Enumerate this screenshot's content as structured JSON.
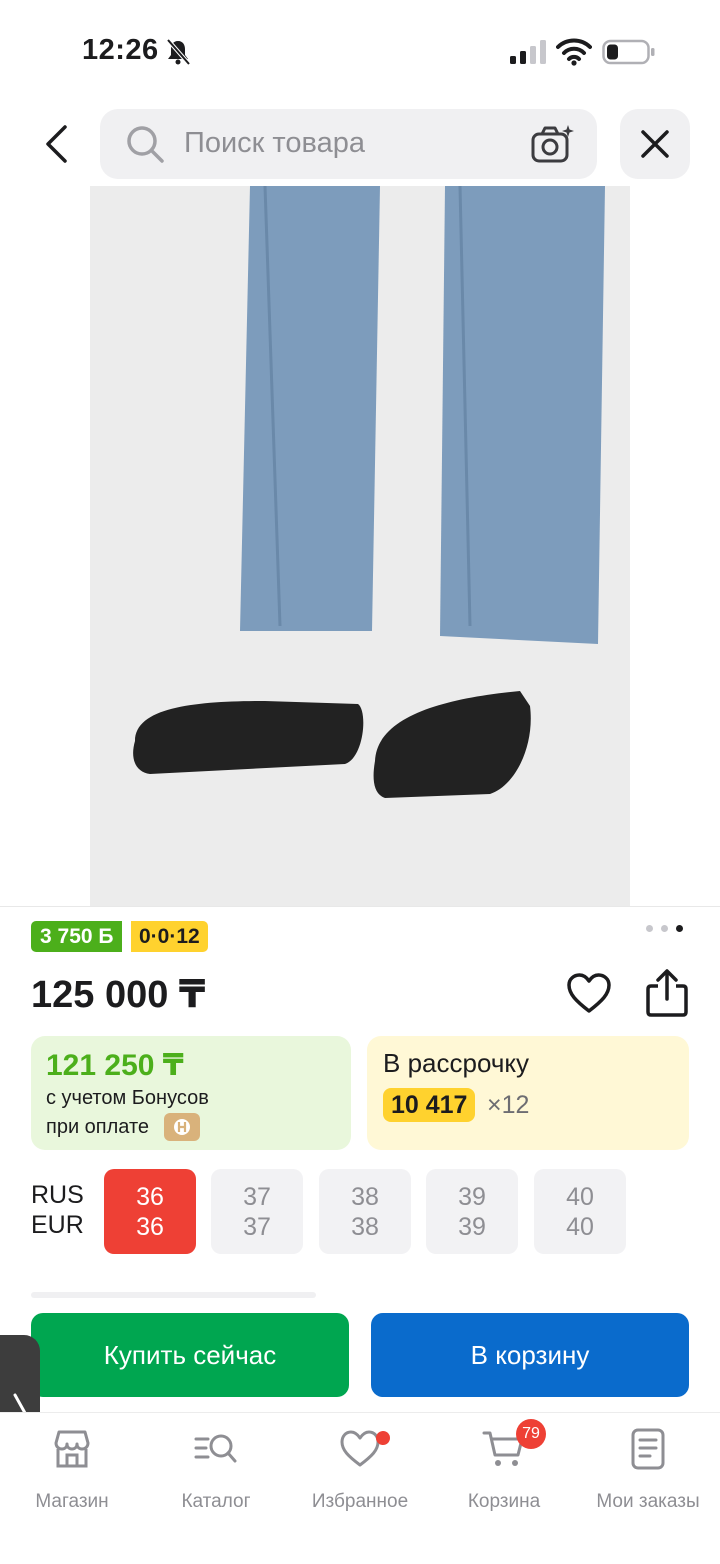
{
  "status_bar": {
    "time": "12:26"
  },
  "search": {
    "placeholder": "Поиск товара"
  },
  "product": {
    "image_alt": "Фото товара",
    "badge_bonus": "3 750 Б",
    "badge_installment": "0·0·12",
    "price": "125 000 ₸",
    "image_page": 3,
    "image_count": 3
  },
  "bonus_card": {
    "price": "121 250 ₸",
    "line1": "с учетом Бонусов",
    "line2": "при оплате"
  },
  "installment_card": {
    "title": "В рассрочку",
    "amount": "10 417",
    "times": "×12"
  },
  "sizes": {
    "label_rus": "RUS",
    "label_eur": "EUR",
    "options": [
      {
        "rus": "36",
        "eur": "36",
        "selected": true
      },
      {
        "rus": "37",
        "eur": "37",
        "selected": false
      },
      {
        "rus": "38",
        "eur": "38",
        "selected": false
      },
      {
        "rus": "39",
        "eur": "39",
        "selected": false
      },
      {
        "rus": "40",
        "eur": "40",
        "selected": false
      }
    ]
  },
  "actions": {
    "buy_now": "Купить сейчас",
    "add_to_cart": "В корзину"
  },
  "nav": {
    "items": [
      {
        "label": "Магазин",
        "icon": "store-icon"
      },
      {
        "label": "Каталог",
        "icon": "catalog-search-icon"
      },
      {
        "label": "Избранное",
        "icon": "heart-icon"
      },
      {
        "label": "Корзина",
        "icon": "cart-icon"
      },
      {
        "label": "Мои заказы",
        "icon": "orders-icon"
      }
    ],
    "cart_count": "79"
  },
  "colors": {
    "accent_green": "#00a650",
    "accent_blue": "#0a6bcc",
    "selected_red": "#ee4035",
    "bonus_green": "#4caf1b",
    "install_yellow": "#ffd22e"
  }
}
